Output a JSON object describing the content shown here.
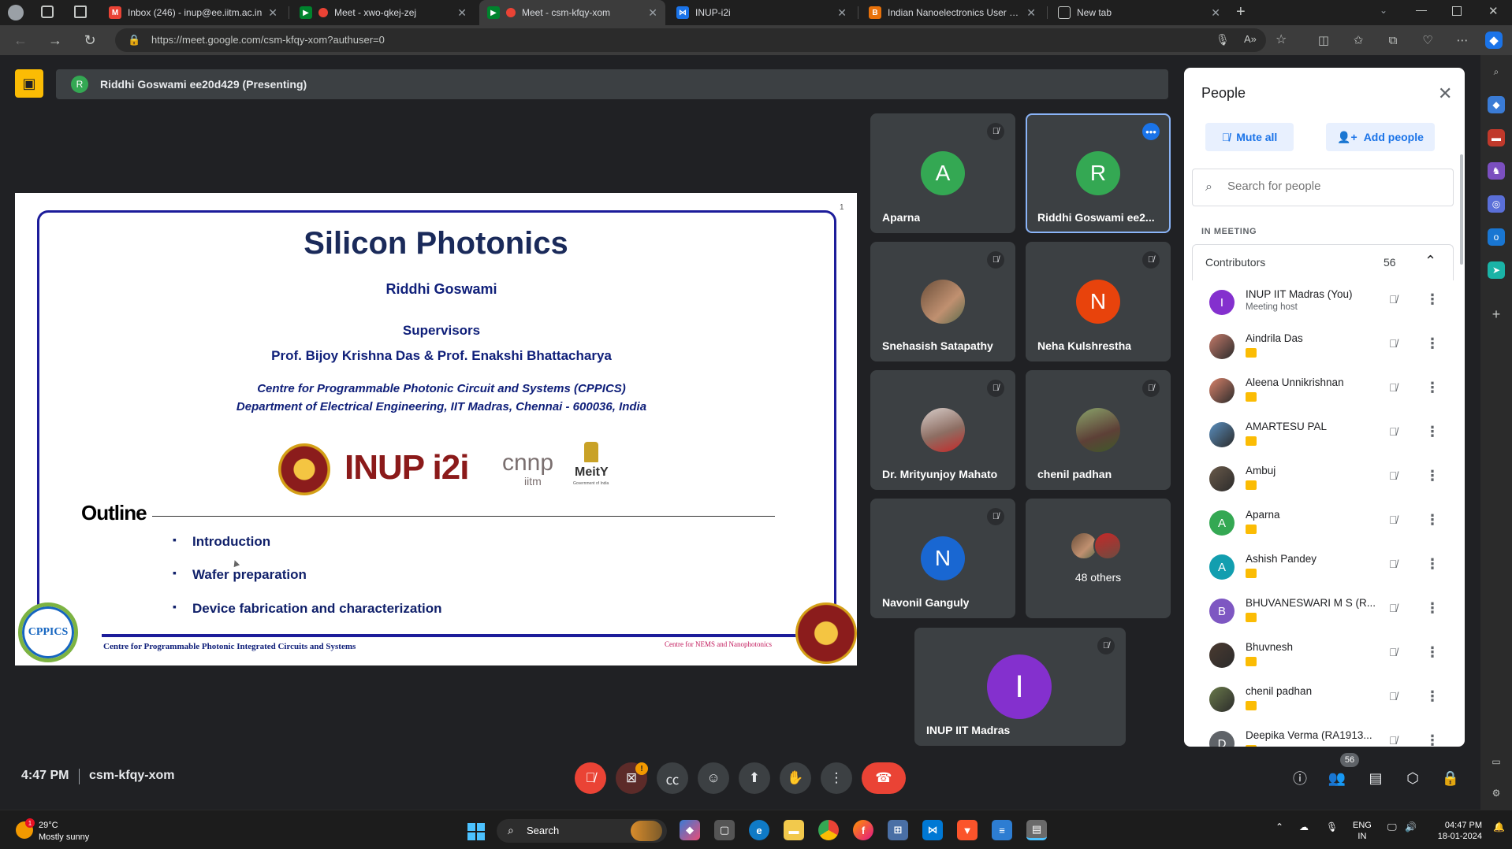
{
  "browser": {
    "tabs": [
      {
        "title": "Inbox (246) - inup@ee.iitm.ac.in",
        "color": "#ea4335",
        "glyph": "M"
      },
      {
        "title": "Meet - xwo-qkej-zej",
        "color": "#00832d",
        "glyph": "●"
      },
      {
        "title": "Meet - csm-kfqy-xom",
        "color": "#00832d",
        "glyph": "●"
      },
      {
        "title": "INUP-i2i",
        "color": "#1a73e8",
        "glyph": "⋈"
      },
      {
        "title": "Indian Nanoelectronics User Prog",
        "color": "#e8710a",
        "glyph": "B"
      },
      {
        "title": "New tab",
        "color": "#5f6368",
        "glyph": "▢"
      }
    ],
    "url": "https://meet.google.com/csm-kfqy-xom?authuser=0"
  },
  "meet": {
    "presenter_initial": "R",
    "presenting_label": "Riddhi Goswami ee20d429 (Presenting)",
    "time": "4:47 PM",
    "meeting_code": "csm-kfqy-xom",
    "alert_count": "!",
    "people_badge": "56"
  },
  "slide": {
    "page_number": "1",
    "title": "Silicon Photonics",
    "author": "Riddhi Goswami",
    "supervisors_heading": "Supervisors",
    "supervisors": "Prof. Bijoy Krishna Das & Prof. Enakshi Bhattacharya",
    "centre": "Centre for Programmable Photonic Circuit and Systems (CPPICS)",
    "department": "Department of Electrical Engineering, IIT Madras, Chennai - 600036, India",
    "logo_inup": "INUP i2i",
    "logo_cnnp": "cnnp",
    "logo_cnnp_sub": "iitm",
    "logo_meity": "MeitY",
    "logo_meity_sub": "Government of India",
    "logo_cppics": "CPPICS",
    "outline_heading": "Outline",
    "outline_items": [
      "Introduction",
      "Wafer preparation",
      "Device fabrication and characterization"
    ],
    "footer": "Centre for Programmable Photonic Integrated Circuits and Systems",
    "footer_right": "Centre for NEMS and Nanophotonics"
  },
  "tiles": [
    {
      "name": "Aparna",
      "initial": "A",
      "color": "#34a853"
    },
    {
      "name": "Riddhi Goswami ee2...",
      "initial": "R",
      "color": "#34a853"
    },
    {
      "name": "Snehasish Satapathy",
      "initial": "",
      "color": ""
    },
    {
      "name": "Neha Kulshrestha",
      "initial": "N",
      "color": "#e8430c"
    },
    {
      "name": "Dr. Mrityunjoy Mahato",
      "initial": "",
      "color": ""
    },
    {
      "name": "chenil padhan",
      "initial": "",
      "color": ""
    },
    {
      "name": "Navonil Ganguly",
      "initial": "N",
      "color": "#1967d2"
    },
    {
      "name": "48 others",
      "initial": "",
      "color": ""
    },
    {
      "name": "INUP IIT Madras",
      "initial": "I",
      "color": "#8430ce"
    }
  ],
  "people": {
    "title": "People",
    "mute_all": "Mute all",
    "add_people": "Add people",
    "search_placeholder": "Search for people",
    "section": "IN MEETING",
    "group_label": "Contributors",
    "group_count": "56",
    "list": [
      {
        "name": "INUP IIT Madras (You)",
        "sub": "Meeting host",
        "initial": "I",
        "color": "#8430ce"
      },
      {
        "name": "Aindrila Das",
        "sub": "",
        "initial": "",
        "color": "#c47a6a"
      },
      {
        "name": "Aleena Unnikrishnan",
        "sub": "",
        "initial": "",
        "color": "#d9826a"
      },
      {
        "name": "AMARTESU PAL",
        "sub": "",
        "initial": "",
        "color": "#5a8fbf"
      },
      {
        "name": "Ambuj",
        "sub": "",
        "initial": "",
        "color": "#6a5a4a"
      },
      {
        "name": "Aparna",
        "sub": "",
        "initial": "A",
        "color": "#34a853"
      },
      {
        "name": "Ashish Pandey",
        "sub": "",
        "initial": "A",
        "color": "#129eaf"
      },
      {
        "name": "BHUVANESWARI M S (R...",
        "sub": "",
        "initial": "B",
        "color": "#7e57c2"
      },
      {
        "name": "Bhuvnesh",
        "sub": "",
        "initial": "",
        "color": "#4a3a30"
      },
      {
        "name": "chenil padhan",
        "sub": "",
        "initial": "",
        "color": "#6a7a4a"
      },
      {
        "name": "Deepika Verma (RA1913...",
        "sub": "",
        "initial": "D",
        "color": "#5f6368"
      }
    ]
  },
  "taskbar": {
    "weather_badge": "1",
    "temperature": "29°C",
    "weather": "Mostly sunny",
    "search": "Search",
    "lang1": "ENG",
    "lang2": "IN",
    "time": "04:47 PM",
    "date": "18-01-2024"
  }
}
